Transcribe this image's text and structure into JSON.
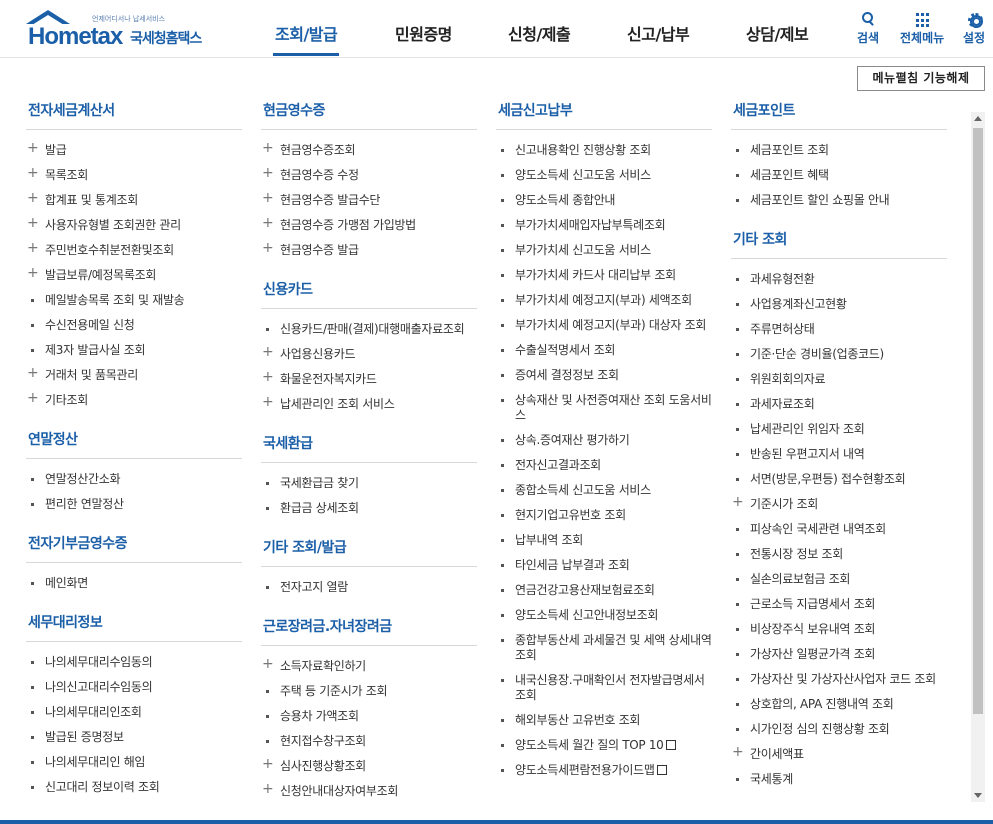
{
  "brand": {
    "tagline": "언제어디서나 납세서비스",
    "name": "Hometax",
    "name_ko": "국세청홈택스"
  },
  "gnb": [
    {
      "label": "조회/발급",
      "active": true
    },
    {
      "label": "민원증명"
    },
    {
      "label": "신청/제출"
    },
    {
      "label": "신고/납부"
    },
    {
      "label": "상담/제보"
    }
  ],
  "util": {
    "search_label": "검색",
    "search_icon": "search-icon",
    "menu_label": "전체메뉴",
    "menu_icon": "grid-icon",
    "settings_label": "설정",
    "settings_icon": "gear-icon"
  },
  "toggle_button": "메뉴펼침 기능해제",
  "colors": {
    "accent": "#1b5fa8"
  },
  "columns": [
    {
      "sections": [
        {
          "title": "전자세금계산서",
          "items": [
            {
              "label": "발급",
              "plus": true
            },
            {
              "label": "목록조회",
              "plus": true
            },
            {
              "label": "합계표 및 통계조회",
              "plus": true
            },
            {
              "label": "사용자유형별 조회권한 관리",
              "plus": true
            },
            {
              "label": "주민번호수취분전환및조회",
              "plus": true
            },
            {
              "label": "발급보류/예정목록조회",
              "plus": true
            },
            {
              "label": "메일발송목록 조회 및 재발송"
            },
            {
              "label": "수신전용메일 신청"
            },
            {
              "label": "제3자 발급사실 조회"
            },
            {
              "label": "거래처 및 품목관리",
              "plus": true
            },
            {
              "label": "기타조회",
              "plus": true
            }
          ]
        },
        {
          "title": "연말정산",
          "items": [
            {
              "label": "연말정산간소화"
            },
            {
              "label": "편리한 연말정산"
            }
          ]
        },
        {
          "title": "전자기부금영수증",
          "items": [
            {
              "label": "메인화면"
            }
          ]
        },
        {
          "title": "세무대리정보",
          "items": [
            {
              "label": "나의세무대리수임동의"
            },
            {
              "label": "나의신고대리수임동의"
            },
            {
              "label": "나의세무대리인조회"
            },
            {
              "label": "발급된 증명정보"
            },
            {
              "label": "나의세무대리인 해임"
            },
            {
              "label": "신고대리 정보이력 조회"
            }
          ]
        }
      ]
    },
    {
      "sections": [
        {
          "title": "현금영수증",
          "items": [
            {
              "label": "현금영수증조회",
              "plus": true
            },
            {
              "label": "현금영수증 수정",
              "plus": true
            },
            {
              "label": "현금영수증 발급수단",
              "plus": true
            },
            {
              "label": "현금영수증 가맹점 가입방법",
              "plus": true
            },
            {
              "label": "현금영수증 발급",
              "plus": true
            }
          ]
        },
        {
          "title": "신용카드",
          "items": [
            {
              "label": "신용카드/판매(결제)대행매출자료조회"
            },
            {
              "label": "사업용신용카드",
              "plus": true
            },
            {
              "label": "화물운전자복지카드",
              "plus": true
            },
            {
              "label": "납세관리인 조회 서비스",
              "plus": true
            }
          ]
        },
        {
          "title": "국세환급",
          "items": [
            {
              "label": "국세환급금 찾기"
            },
            {
              "label": "환급금 상세조회"
            }
          ]
        },
        {
          "title": "기타 조회/발급",
          "items": [
            {
              "label": "전자고지 열람"
            }
          ]
        },
        {
          "title": "근로장려금.자녀장려금",
          "items": [
            {
              "label": "소득자료확인하기",
              "plus": true
            },
            {
              "label": "주택 등 기준시가 조회"
            },
            {
              "label": "승용차 가액조회"
            },
            {
              "label": "현지접수창구조회"
            },
            {
              "label": "심사진행상황조회",
              "plus": true
            },
            {
              "label": "신청안내대상자여부조회",
              "plus": true
            }
          ]
        }
      ]
    },
    {
      "sections": [
        {
          "title": "세금신고납부",
          "items": [
            {
              "label": "신고내용확인 진행상황 조회"
            },
            {
              "label": "양도소득세 신고도움 서비스"
            },
            {
              "label": "양도소득세 종합안내"
            },
            {
              "label": "부가가치세매입자납부특례조회"
            },
            {
              "label": "부가가치세 신고도움 서비스"
            },
            {
              "label": "부가가치세 카드사 대리납부 조회"
            },
            {
              "label": "부가가치세 예정고지(부과) 세액조회"
            },
            {
              "label": "부가가치세 예정고지(부과) 대상자 조회"
            },
            {
              "label": "수출실적명세서 조회"
            },
            {
              "label": "증여세 결정정보 조회"
            },
            {
              "label": "상속재산 및 사전증여재산 조회 도움서비스"
            },
            {
              "label": "상속.증여재산 평가하기"
            },
            {
              "label": "전자신고결과조회"
            },
            {
              "label": "종합소득세 신고도움 서비스"
            },
            {
              "label": "현지기업고유번호 조회"
            },
            {
              "label": "납부내역 조회"
            },
            {
              "label": "타인세금 납부결과 조회"
            },
            {
              "label": "연금건강고용산재보험료조회"
            },
            {
              "label": "양도소득세 신고안내정보조회"
            },
            {
              "label": "종합부동산세 과세물건 및 세액 상세내역 조회"
            },
            {
              "label": "내국신용장.구매확인서 전자발급명세서 조회"
            },
            {
              "label": "해외부동산 고유번호 조회"
            },
            {
              "label": "양도소득세 월간 질의 TOP 10",
              "ext": true
            },
            {
              "label": "양도소득세편람전용가이드맵",
              "ext": true
            }
          ]
        }
      ]
    },
    {
      "sections": [
        {
          "title": "세금포인트",
          "items": [
            {
              "label": "세금포인트 조회"
            },
            {
              "label": "세금포인트 혜택"
            },
            {
              "label": "세금포인트 할인 쇼핑몰 안내"
            }
          ]
        },
        {
          "title": "기타 조회",
          "items": [
            {
              "label": "과세유형전환"
            },
            {
              "label": "사업용계좌신고현황"
            },
            {
              "label": "주류면허상태"
            },
            {
              "label": "기준·단순 경비율(업종코드)"
            },
            {
              "label": "위원회회의자료"
            },
            {
              "label": "과세자료조회"
            },
            {
              "label": "납세관리인 위임자 조회"
            },
            {
              "label": "반송된 우편고지서 내역"
            },
            {
              "label": "서면(방문,우편등) 접수현황조회"
            },
            {
              "label": "기준시가 조회",
              "plus": true
            },
            {
              "label": "피상속인 국세관련 내역조회"
            },
            {
              "label": "전통시장 정보 조회"
            },
            {
              "label": "실손의료보험금 조회"
            },
            {
              "label": "근로소득 지급명세서 조회"
            },
            {
              "label": "비상장주식 보유내역 조회"
            },
            {
              "label": "가상자산 일평균가격 조회"
            },
            {
              "label": "가상자산 및 가상자산사업자 코드 조회"
            },
            {
              "label": "상호합의, APA 진행내역 조회"
            },
            {
              "label": "시가인정 심의 진행상황 조회"
            },
            {
              "label": "간이세액표",
              "plus": true
            },
            {
              "label": "국세통계"
            }
          ]
        }
      ]
    }
  ]
}
